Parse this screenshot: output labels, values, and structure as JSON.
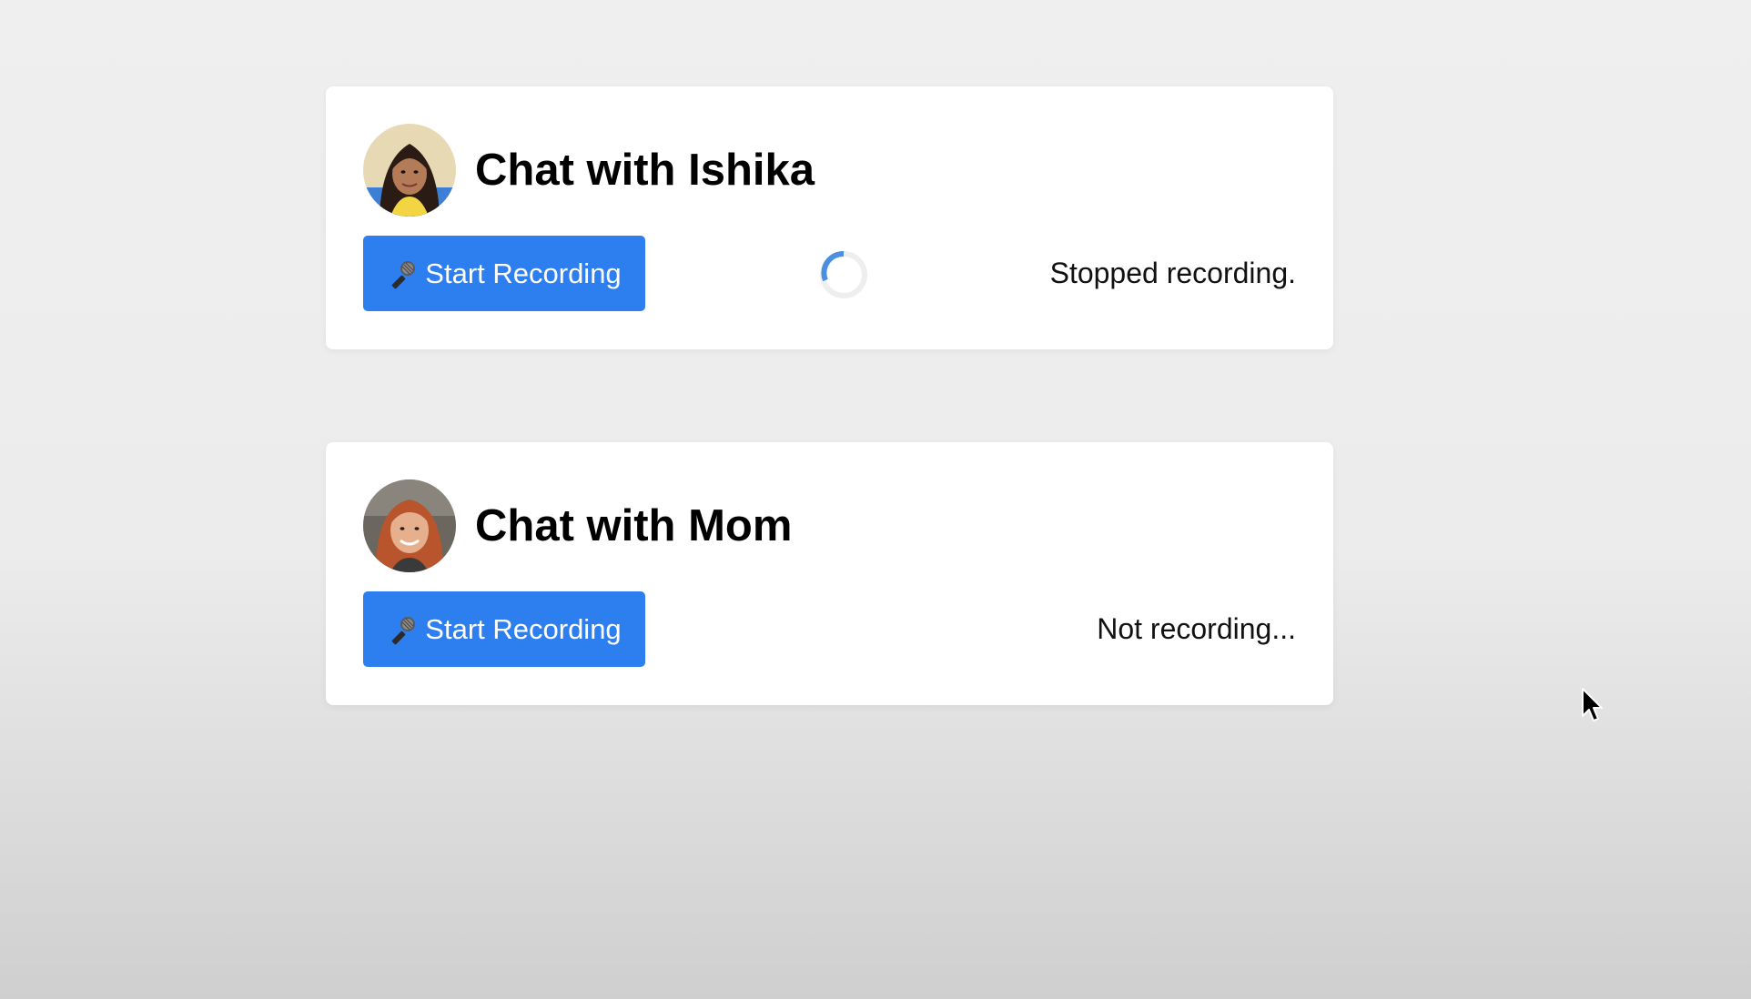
{
  "chats": [
    {
      "title": "Chat with Ishika",
      "button_label": "Start Recording",
      "button_icon": "microphone-icon",
      "status": "Stopped recording.",
      "loading": true
    },
    {
      "title": "Chat with Mom",
      "button_label": "Start Recording",
      "button_icon": "microphone-icon",
      "status": "Not recording...",
      "loading": false
    }
  ],
  "colors": {
    "button_bg": "#2d7ff0",
    "card_bg": "#ffffff",
    "spinner_accent": "#4a8fe0"
  }
}
